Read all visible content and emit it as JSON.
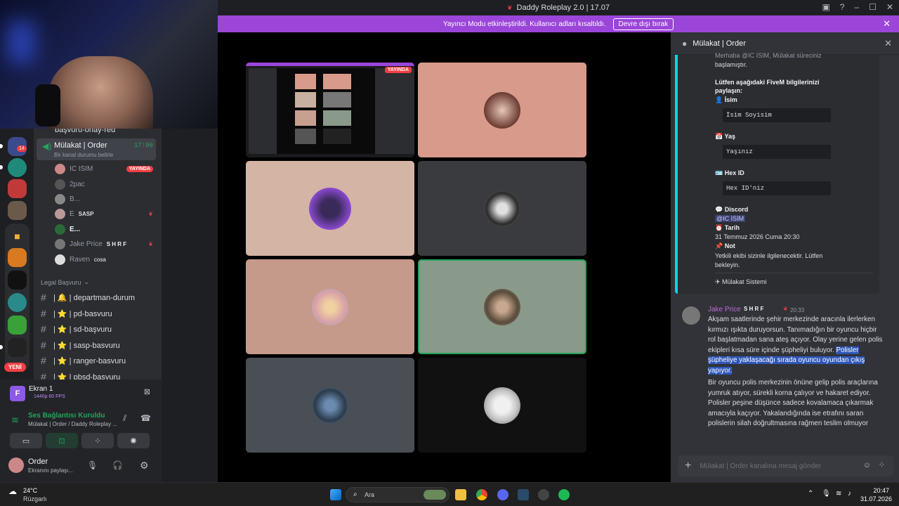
{
  "window": {
    "title": "Daddy Roleplay 2.0 | 17.07"
  },
  "streamer_banner": {
    "text": "Yayıncı Modu etkinleştirildi. Kullanıcı adları kısaltıldı.",
    "button": "Devre dışı bırak"
  },
  "server_rail": {
    "new_badge": "YENİ",
    "mention_count": "14"
  },
  "channels": {
    "partial_top": "başvuru-onay-red",
    "active_voice": {
      "name": "Mülakat | Order",
      "time": "17:06",
      "status": "Bir kanal durumu belirle"
    },
    "voice_users": [
      {
        "name": "IC ISIM",
        "badge": "YAYINDA"
      },
      {
        "name": "2pac",
        "badge": ""
      },
      {
        "name": "B...",
        "badge": ""
      },
      {
        "name": "E",
        "badge": "SASP"
      },
      {
        "name": "E...",
        "badge": ""
      },
      {
        "name": "Jake Price",
        "badge": "S H R F"
      },
      {
        "name": "Raven",
        "badge": "cosa"
      }
    ],
    "category": "Legal Başvuru",
    "text_channels": [
      "| 🔔 | departman-durum",
      "| ⭐ | pd-basvuru",
      "| ⭐ | sd-başvuru",
      "| ⭐ | sasp-basvuru",
      "| ⭐ | ranger-basvuru",
      "| ⭐ | pbsd-basvuru"
    ]
  },
  "screen_share": {
    "title": "Ekran 1",
    "quality": "1440p 60 FPS"
  },
  "voice_connection": {
    "status": "Ses Bağlantısı Kuruldu",
    "channel": "Mülakat | Order / Daddy Roleplay ..."
  },
  "user_panel": {
    "name": "Order",
    "status": "Ekranını paylaşı..."
  },
  "stage": {
    "live_badge": "YAYINDA"
  },
  "chat": {
    "header": "Mülakat | Order",
    "embed": {
      "intro_partial": "Merhaba @IC ISIM, Mülakat süreciniz",
      "intro2": "başlamıştır.",
      "ask_title": "Lütfen aşağıdaki FiveM bilgilerinizi paylaşın:",
      "fields": [
        {
          "label": "İsim",
          "value": "İsim Soyisim"
        },
        {
          "label": "Yaş",
          "value": "Yaşınız"
        },
        {
          "label": "Hex ID",
          "value": "Hex ID'niz"
        }
      ],
      "discord_label": "Discord",
      "discord_value": "@IC ISIM",
      "date_label": "Tarih",
      "date_value": "31 Temmuz 2026 Cuma 20:30",
      "note_label": "Not",
      "note_value": "Yetkili ekibi sizinle ilgilenecektir. Lütfen bekleyin.",
      "footer": "Mülakat Sistemi"
    },
    "message": {
      "author": "Jake Price",
      "author_badge": "S H R F",
      "time": "20:33",
      "para1": "Akşam saatlerinde şehir merkezinde aracınla ilerlerken kırmızı ışıkta duruyorsun. Tanımadığın bir oyuncu hiçbir rol başlatmadan sana ateş açıyor. Olay yerine gelen polis ekipleri kısa süre içinde şüpheliyi buluyor.",
      "para1_highlight": "Polisler şüpheliye yaklaşacağı sırada oyuncu oyundan çıkış yapıyor.",
      "para2": "Bir oyuncu polis merkezinin önüne gelip polis araçlarına yumruk atıyor, sürekli korna çalıyor ve hakaret ediyor. Polisler peşine düşünce sadece kovalamaca çıkarmak amacıyla kaçıyor. Yakalandığında ise etrafını saran polislerin silah doğrultmasına rağmen teslim olmuyor"
    },
    "composer_placeholder": "Mülakat | Order kanalına mesaj gönder"
  },
  "taskbar": {
    "weather_temp": "24°C",
    "weather_text": "Rüzgarlı",
    "search": "Ara",
    "time": "20:47",
    "date": "31.07.2026"
  },
  "colors": {
    "accent": "#9b45d9",
    "embed_bar": "#00d8e8",
    "voice_green": "#23a55a",
    "live_red": "#f23f43"
  }
}
